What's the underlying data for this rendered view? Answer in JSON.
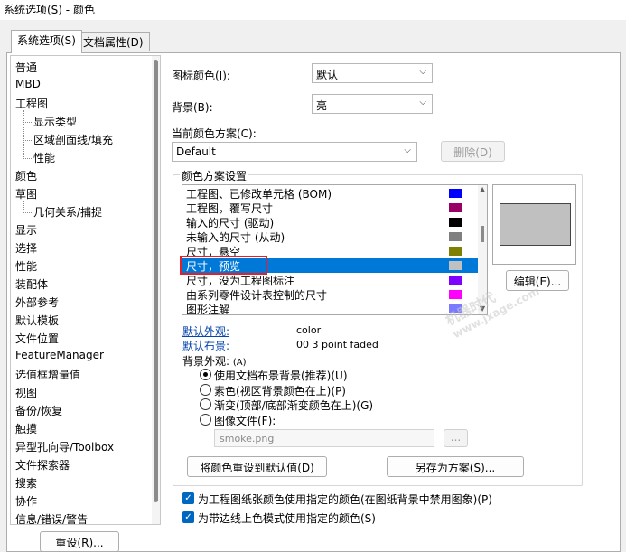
{
  "window": {
    "title": "系统选项(S) - 颜色"
  },
  "tabs": [
    {
      "label": "系统选项(S)",
      "active": true
    },
    {
      "label": "文档属性(D)",
      "active": false
    }
  ],
  "tree": {
    "items": [
      {
        "label": "普通",
        "level": 0
      },
      {
        "label": "MBD",
        "level": 0
      },
      {
        "label": "工程图",
        "level": 0
      },
      {
        "label": "显示类型",
        "level": 1
      },
      {
        "label": "区域剖面线/填充",
        "level": 1
      },
      {
        "label": "性能",
        "level": 1
      },
      {
        "label": "颜色",
        "level": 0,
        "selected": true
      },
      {
        "label": "草图",
        "level": 0
      },
      {
        "label": "几何关系/捕捉",
        "level": 1
      },
      {
        "label": "显示",
        "level": 0
      },
      {
        "label": "选择",
        "level": 0
      },
      {
        "label": "性能",
        "level": 0
      },
      {
        "label": "装配体",
        "level": 0
      },
      {
        "label": "外部参考",
        "level": 0
      },
      {
        "label": "默认模板",
        "level": 0
      },
      {
        "label": "文件位置",
        "level": 0
      },
      {
        "label": "FeatureManager",
        "level": 0
      },
      {
        "label": "选值框增量值",
        "level": 0
      },
      {
        "label": "视图",
        "level": 0
      },
      {
        "label": "备份/恢复",
        "level": 0
      },
      {
        "label": "触摸",
        "level": 0
      },
      {
        "label": "异型孔向导/Toolbox",
        "level": 0
      },
      {
        "label": "文件探索器",
        "level": 0
      },
      {
        "label": "搜索",
        "level": 0
      },
      {
        "label": "协作",
        "level": 0
      },
      {
        "label": "信息/错误/警告",
        "level": 0
      }
    ]
  },
  "reset_button": "重设(R)...",
  "icon_color": {
    "label": "图标颜色(I):",
    "value": "默认"
  },
  "background": {
    "label": "背景(B):",
    "value": "亮"
  },
  "scheme": {
    "label": "当前颜色方案(C):",
    "value": "Default",
    "delete_button": "删除(D)"
  },
  "scheme_settings": {
    "group_label": "颜色方案设置",
    "items": [
      {
        "label": "工程图、已修改单元格 (BOM)",
        "color": "#0000ff"
      },
      {
        "label": "工程图，覆写尺寸",
        "color": "#990066"
      },
      {
        "label": "输入的尺寸 (驱动)",
        "color": "#000000"
      },
      {
        "label": "未输入的尺寸 (从动)",
        "color": "#7f7f7f"
      },
      {
        "label": "尺寸，悬空",
        "color": "#808000"
      },
      {
        "label": "尺寸，预览",
        "color": "#c0c0c0",
        "selected": true
      },
      {
        "label": "尺寸，没为工程图标注",
        "color": "#8000ff"
      },
      {
        "label": "由系列零件设计表控制的尺寸",
        "color": "#ff00ff"
      },
      {
        "label": "图形注解",
        "color": "#7a7aff"
      }
    ],
    "edit_button": "编辑(E)...",
    "default_appearance_link": "默认外观:",
    "default_appearance_value": "color",
    "default_scene_link": "默认布景:",
    "default_scene_value": "00 3 point faded",
    "bg_appearance_label": "背景外观:",
    "bg_appearance_key": "(A)",
    "radios": [
      {
        "label": "使用文档布景背景(推荐)(U)",
        "checked": true
      },
      {
        "label": "素色(视区背景颜色在上)(P)",
        "checked": false
      },
      {
        "label": "渐变(顶部/底部渐变颜色在上)(G)",
        "checked": false
      },
      {
        "label": "图像文件(F):",
        "checked": false
      }
    ],
    "image_file_value": "smoke.png",
    "browse_button": "...",
    "reset_defaults_button": "将颜色重设到默认值(D)",
    "save_scheme_button": "另存为方案(S)..."
  },
  "checkboxes": [
    {
      "label": "为工程图纸张颜色使用指定的颜色(在图纸背景中禁用图象)(P)",
      "checked": true
    },
    {
      "label": "为带边线上色模式使用指定的颜色(S)",
      "checked": true
    }
  ],
  "watermark": {
    "line1": "机器时代",
    "line2": "www.jxage.com"
  }
}
